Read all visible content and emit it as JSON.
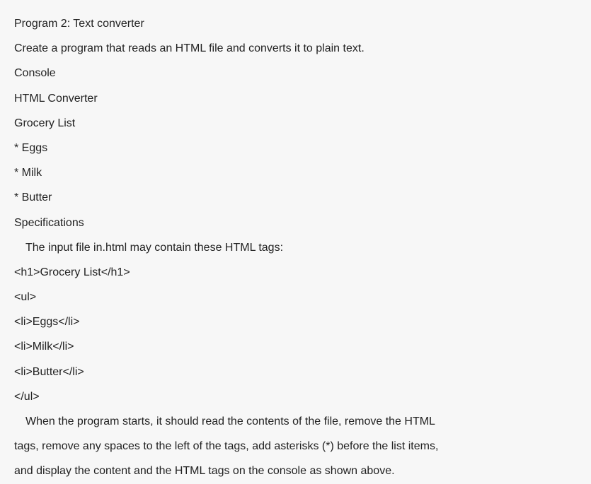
{
  "lines": {
    "title": "Program 2: Text converter",
    "desc": "Create a program that reads an HTML file and converts it to plain text.",
    "console_label": "Console",
    "console_heading": "HTML Converter",
    "grocery_list": "Grocery List",
    "item_eggs": "* Eggs",
    "item_milk": "* Milk",
    "item_butter": "* Butter",
    "specs_label": "Specifications",
    "spec_input": "The input file in.html may contain these HTML tags:",
    "tag_h1": "<h1>Grocery List</h1>",
    "tag_ul_open": "<ul>",
    "tag_li_eggs": "<li>Eggs</li>",
    "tag_li_milk": "<li>Milk</li>",
    "tag_li_butter": "<li>Butter</li>",
    "tag_ul_close": "</ul>",
    "spec_behavior_1": "When the program starts, it should read the contents of the file, remove the HTML",
    "spec_behavior_2": "tags, remove any spaces to the left of the tags, add asterisks (*) before the list items,",
    "spec_behavior_3": "and display the content and the HTML tags on the console as shown above."
  }
}
